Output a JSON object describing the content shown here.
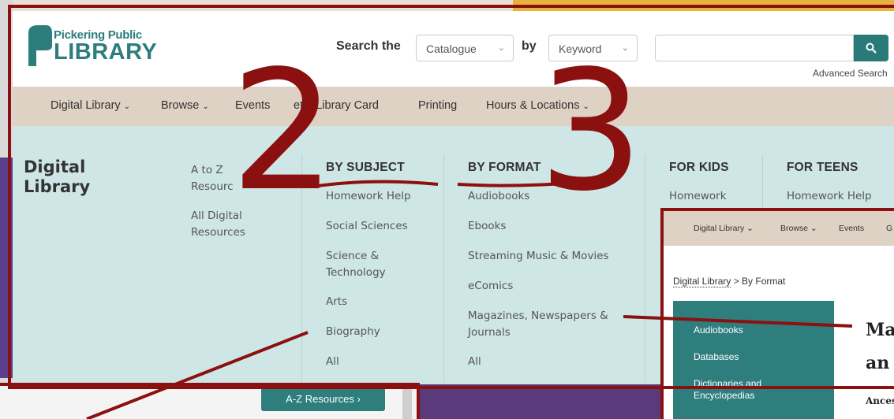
{
  "header": {
    "logo_small": "Pickering Public",
    "logo_big": "LIBRARY",
    "search_label": "Search the",
    "scope_value": "Catalogue",
    "by_label": "by",
    "field_value": "Keyword",
    "search_placeholder": "",
    "advanced_search": "Advanced Search"
  },
  "nav": {
    "items": [
      {
        "label": "Digital Library"
      },
      {
        "label": "Browse"
      },
      {
        "label": "Events"
      },
      {
        "label": "et a Library Card"
      },
      {
        "label": "Printing"
      },
      {
        "label": "Hours & Locations"
      }
    ]
  },
  "mega": {
    "title_line1": "Digital",
    "title_line2": "Library",
    "col1": [
      "A to Z",
      "Resourc",
      "All Digital",
      "Resources"
    ],
    "by_subject": {
      "heading": "BY SUBJECT",
      "links": [
        "Homework Help",
        "Social Sciences",
        "Science &",
        "Technology",
        "Arts",
        "Biography",
        "All"
      ]
    },
    "by_format": {
      "heading": "BY FORMAT",
      "links": [
        "Audiobooks",
        "Ebooks",
        "Streaming Music & Movies",
        "eComics",
        "Magazines, Newspapers &",
        "Journals",
        "All"
      ]
    },
    "for_kids": {
      "heading": "FOR KIDS",
      "links": [
        "Homework"
      ]
    },
    "for_teens": {
      "heading": "FOR TEENS",
      "links": [
        "Homework Help"
      ]
    }
  },
  "annotations": {
    "num_2": "2",
    "num_3": "3",
    "color": "#8b1010"
  },
  "inset_bottom": {
    "az_button": "A-Z Resources  ›"
  },
  "inset_right": {
    "nav": [
      "Digital Library ⌄",
      "Browse ⌄",
      "Events",
      "G"
    ],
    "crumb_link": "Digital Library",
    "crumb_rest": " > By Format",
    "side": [
      "Audiobooks",
      "Databases",
      "Dictionaries and",
      "Encyclopedias"
    ],
    "heading1": "Ma",
    "heading2": "an",
    "sub": "Ances"
  },
  "colors": {
    "teal": "#2e7d7d",
    "nav_bg": "#ddd2c4",
    "mega_bg": "#cfe6e6"
  }
}
